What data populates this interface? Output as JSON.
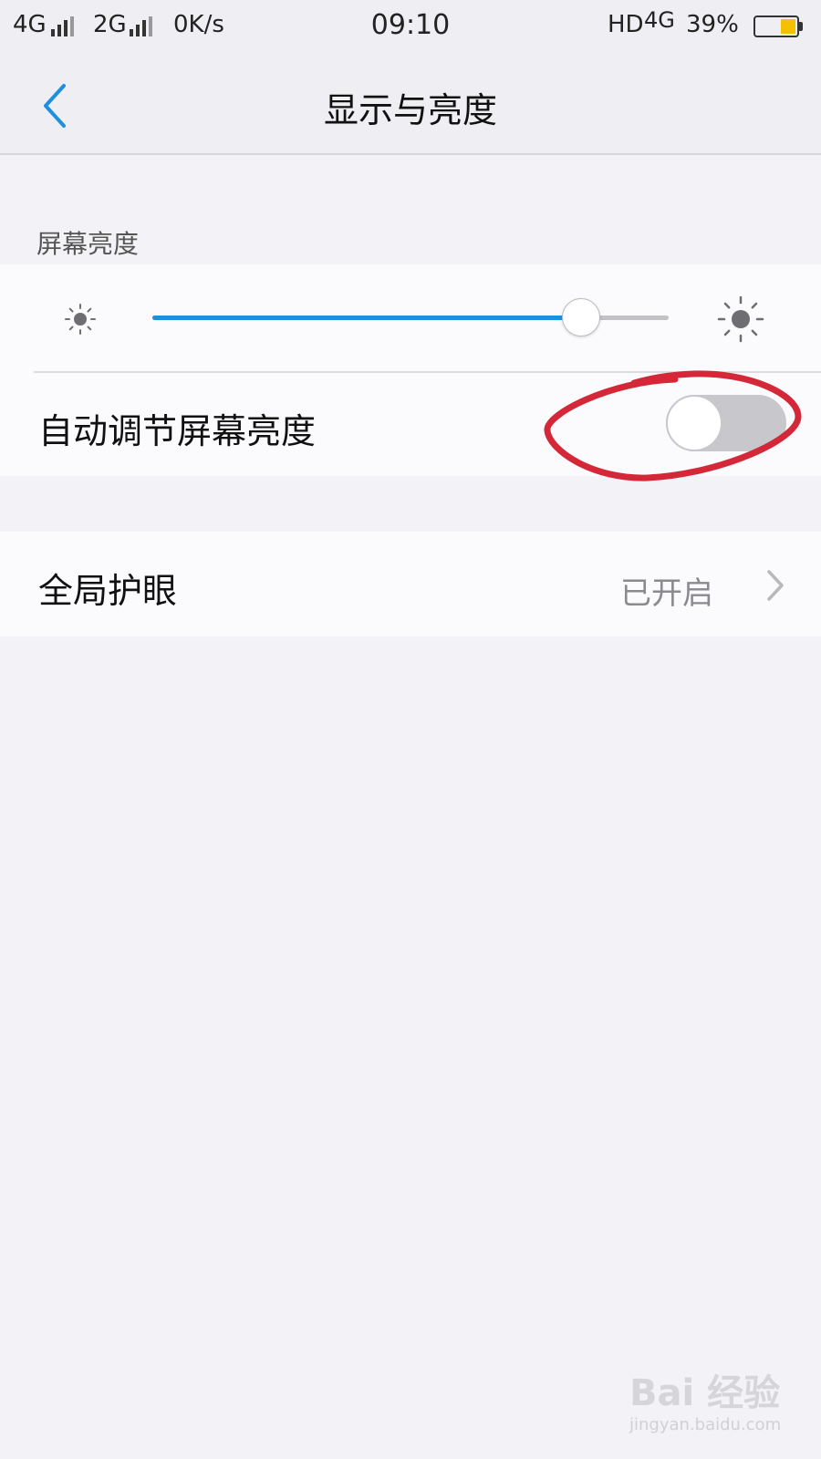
{
  "status_bar": {
    "net1": "4G",
    "net2": "2G",
    "speed": "0K/s",
    "time": "09:10",
    "hd": "HD",
    "net3": "4G",
    "battery_percent": "39%",
    "battery_level": 0.39,
    "battery_color": "#f5c000"
  },
  "nav": {
    "back_icon": "chevron-left-icon",
    "title": "显示与亮度",
    "accent": "#1f8fe0"
  },
  "brightness": {
    "section_label": "屏幕亮度",
    "level": 0.83,
    "min_icon": "sun-small-icon",
    "max_icon": "sun-large-icon",
    "fill_color": "#1f8fe0"
  },
  "auto_brightness": {
    "label": "自动调节屏幕亮度",
    "enabled": false
  },
  "eye_care": {
    "label": "全局护眼",
    "value": "已开启",
    "arrow_icon": "chevron-right-icon"
  },
  "annotation": {
    "shape": "red-hand-drawn-circle",
    "color": "#d42838"
  },
  "watermark": {
    "brand": "Bai 经验",
    "url": "jingyan.baidu.com"
  }
}
